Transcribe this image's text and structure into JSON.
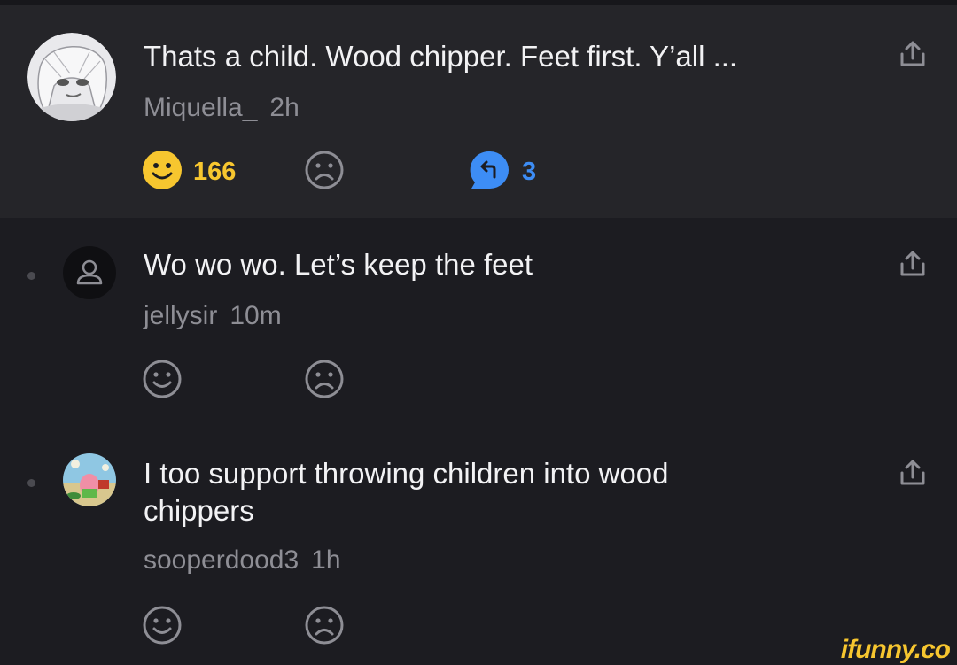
{
  "comments": [
    {
      "text": "Thats a child. Wood chipper. Feet first. Y’all ...",
      "username": "Miquella_",
      "time": "2h",
      "smile_count": "166",
      "reply_count": "3"
    },
    {
      "text": "Wo wo wo. Let’s keep the feet",
      "username": "jellysir",
      "time": "10m"
    },
    {
      "text": "I too support throwing children into wood chippers",
      "username": "sooperdood3",
      "time": "1h"
    }
  ],
  "watermark": "ifunny.co",
  "colors": {
    "accent_yellow": "#f7c62f",
    "reply_blue": "#3d8df5",
    "icon_gray": "#8e8e95"
  },
  "icons": [
    "share-icon",
    "smile-icon",
    "frown-icon",
    "reply-icon",
    "user-icon"
  ]
}
